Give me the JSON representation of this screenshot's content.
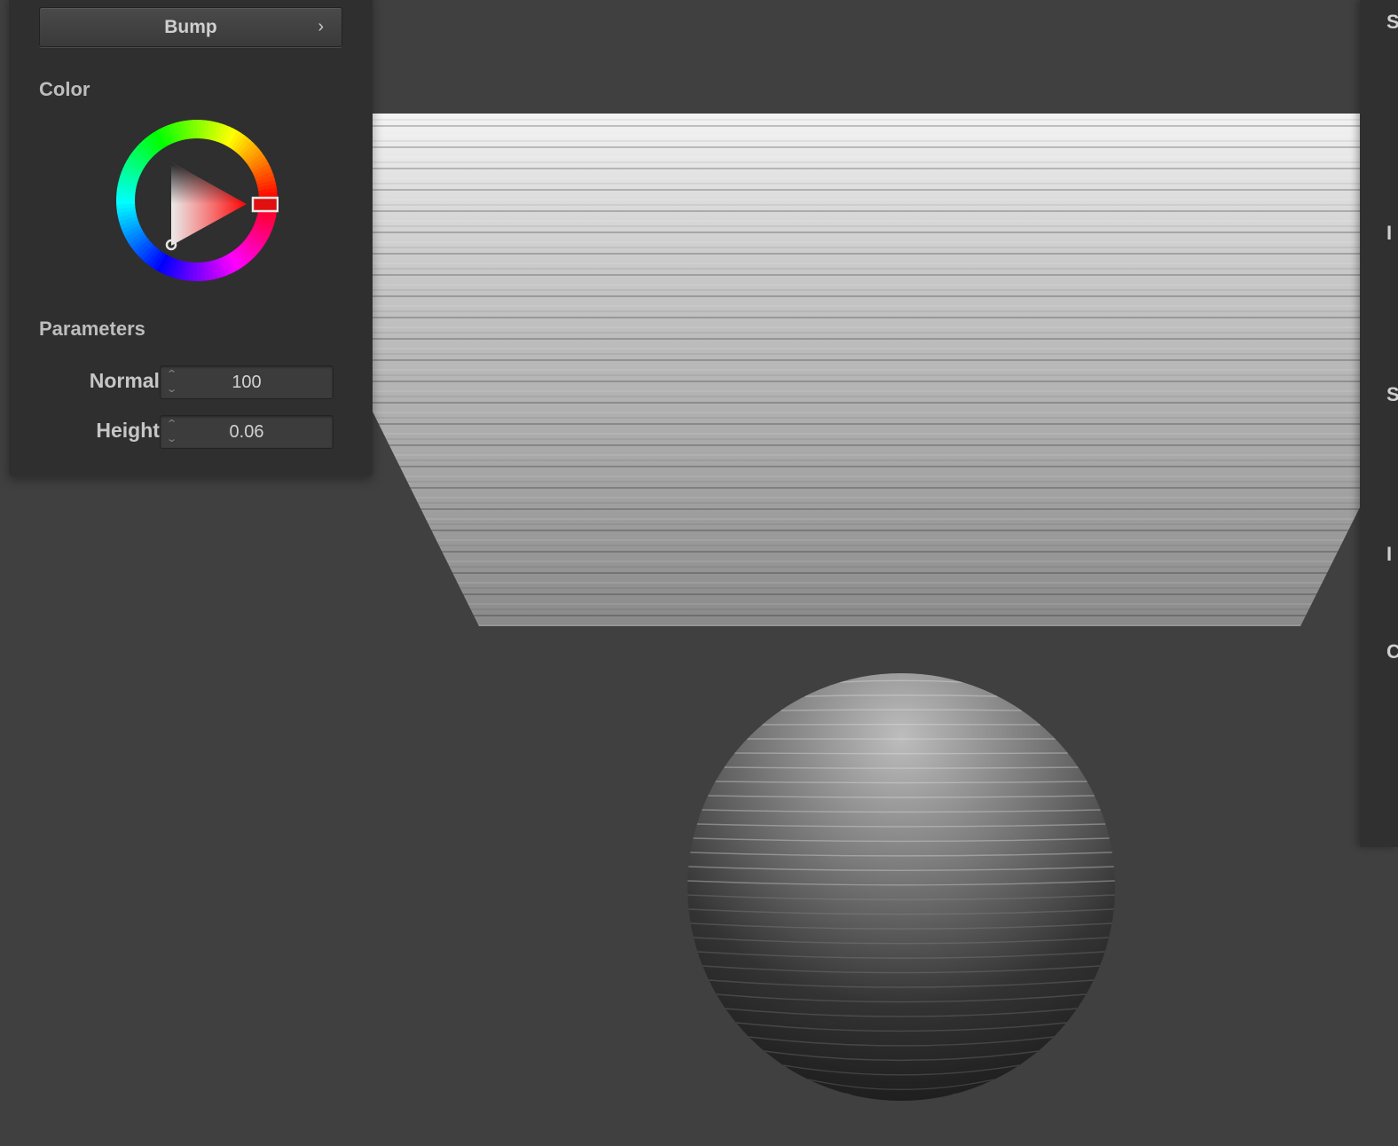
{
  "panel": {
    "mode_button": {
      "label": "Bump",
      "chevron": "›"
    },
    "color_section": {
      "title": "Color",
      "hue_marker_color": "#ff0000"
    },
    "parameters_section": {
      "title": "Parameters",
      "normal": {
        "label": "Normal :",
        "value": "100"
      },
      "height": {
        "label": "Height :",
        "value": "0.06"
      }
    }
  },
  "icons": {
    "spin_up": "⌃",
    "spin_down": "⌄"
  },
  "right_panel": {
    "clipped_letters": [
      "S",
      "I",
      "S",
      "I",
      "C"
    ]
  },
  "colors": {
    "background": "#404040",
    "panel": "#2f2f2f",
    "accent_hue": "#ff0000"
  }
}
